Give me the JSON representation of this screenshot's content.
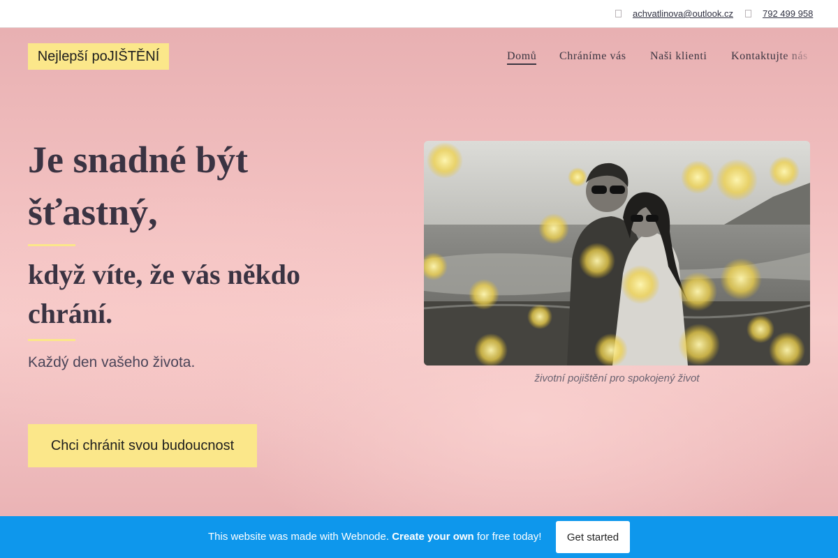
{
  "topbar": {
    "email_icon": "envelope-icon",
    "email": "achvatlinova@outlook.cz",
    "phone_icon": "phone-icon",
    "phone": "792 499 958"
  },
  "header": {
    "logo": "Nejlepší poJIŠTĚNÍ",
    "nav": [
      {
        "label": "Domů",
        "active": true
      },
      {
        "label": "Chráníme vás",
        "active": false
      },
      {
        "label": "Naši klienti",
        "active": false
      },
      {
        "label": "Kontaktujte nás",
        "active": false
      }
    ]
  },
  "hero": {
    "headline": "Je snadné být šťastný,",
    "subheadline": "když víte, že vás někdo chrání.",
    "tagline": "Každý den vašeho života.",
    "cta": "Chci chránit svou budoucnost",
    "image_caption": "životní pojištění pro spokojený život"
  },
  "banner": {
    "text_before": "This website was made with Webnode.",
    "text_bold": "Create your own",
    "text_after": "for free today!",
    "button": "Get started"
  },
  "colors": {
    "accent_yellow": "#fbe78a",
    "banner_blue": "#0e97ec",
    "text_dark": "#3a3342"
  }
}
